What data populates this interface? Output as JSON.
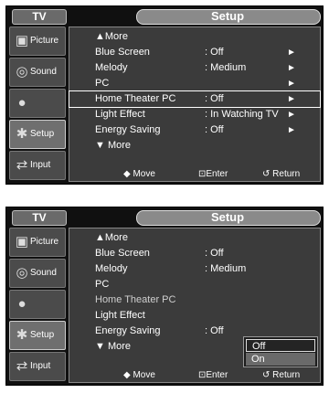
{
  "panels": [
    {
      "tv_label": "TV",
      "title": "Setup",
      "sidebar": [
        {
          "label": "Picture",
          "icon": "picture-icon"
        },
        {
          "label": "Sound",
          "icon": "sound-icon"
        },
        {
          "label": "",
          "icon": "channel-icon"
        },
        {
          "label": "Setup",
          "icon": "setup-icon"
        },
        {
          "label": "Input",
          "icon": "input-icon"
        }
      ],
      "rows": [
        {
          "label": "▲More",
          "value": "",
          "arrow": ""
        },
        {
          "label": "Blue Screen",
          "value": ": Off",
          "arrow": "►"
        },
        {
          "label": "Melody",
          "value": ": Medium",
          "arrow": "►"
        },
        {
          "label": "PC",
          "value": "",
          "arrow": "►"
        },
        {
          "label": "Home Theater PC",
          "value": ": Off",
          "arrow": "►"
        },
        {
          "label": "Light Effect",
          "value": ": In Watching TV",
          "arrow": "►"
        },
        {
          "label": "Energy Saving",
          "value": ": Off",
          "arrow": "►"
        },
        {
          "label": "▼ More",
          "value": "",
          "arrow": ""
        }
      ],
      "bottom": {
        "move": "◆ Move",
        "enter": "⊡Enter",
        "return": "↺ Return"
      }
    },
    {
      "tv_label": "TV",
      "title": "Setup",
      "sidebar": [
        {
          "label": "Picture",
          "icon": "picture-icon"
        },
        {
          "label": "Sound",
          "icon": "sound-icon"
        },
        {
          "label": "",
          "icon": "channel-icon"
        },
        {
          "label": "Setup",
          "icon": "setup-icon"
        },
        {
          "label": "Input",
          "icon": "input-icon"
        }
      ],
      "rows": [
        {
          "label": "▲More",
          "value": "",
          "arrow": ""
        },
        {
          "label": "Blue Screen",
          "value": ": Off",
          "arrow": ""
        },
        {
          "label": "Melody",
          "value": ": Medium",
          "arrow": ""
        },
        {
          "label": "PC",
          "value": "",
          "arrow": ""
        },
        {
          "label": "Home Theater PC",
          "value": "",
          "arrow": ""
        },
        {
          "label": "Light Effect",
          "value": "",
          "arrow": ""
        },
        {
          "label": "Energy Saving",
          "value": ": Off",
          "arrow": ""
        },
        {
          "label": "▼ More",
          "value": "",
          "arrow": ""
        }
      ],
      "dropdown": {
        "options": [
          "Off",
          "On"
        ],
        "selected": "Off"
      },
      "bottom": {
        "move": "◆ Move",
        "enter": "⊡Enter",
        "return": "↺ Return"
      }
    }
  ],
  "colors": {
    "accent": "#8a8a8a",
    "bg": "#101010",
    "content": "#3b3b3b"
  }
}
